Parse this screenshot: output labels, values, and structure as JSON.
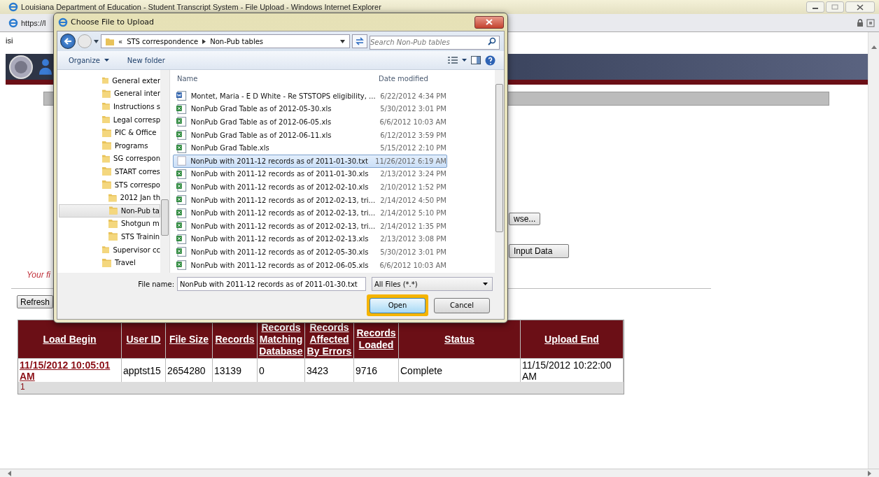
{
  "browser": {
    "title": "Louisiana Department of Education - Student Transcript System - File Upload - Windows Internet Explorer",
    "address": "https://l"
  },
  "page": {
    "user_text": "isi",
    "browse_button": "wse...",
    "input_button": "Input Data",
    "message": "Your fi",
    "refresh_button": "Refresh",
    "table": {
      "columns": [
        "Load Begin",
        "User ID",
        "File Size",
        "Records",
        "Records Matching Database",
        "Records Affected By Errors",
        "Records Loaded",
        "Status",
        "Upload End"
      ],
      "rows": [
        {
          "cells": [
            {
              "text": "11/15/2012 10:05:01 AM",
              "kind": "link"
            },
            {
              "text": "apptst15",
              "kind": "plain"
            },
            {
              "text": "2654280",
              "kind": "plain"
            },
            {
              "text": "13139",
              "kind": "plain"
            },
            {
              "text": "0",
              "kind": "plain"
            },
            {
              "text": "3423",
              "kind": "plain"
            },
            {
              "text": "9716",
              "kind": "plain"
            },
            {
              "text": "Complete",
              "kind": "plain"
            },
            {
              "text": "11/15/2012 10:22:00 AM",
              "kind": "plain"
            }
          ]
        }
      ],
      "pager": "1"
    }
  },
  "dialog": {
    "title": "Choose File to Upload",
    "breadcrumb_overflow": "«",
    "breadcrumb": [
      "STS correspondence",
      "Non-Pub tables"
    ],
    "search": {
      "placeholder": "Search Non-Pub tables"
    },
    "toolbar": [
      "Organize",
      "New folder"
    ],
    "tree": [
      {
        "label": "General exter",
        "selected": false
      },
      {
        "label": "General inter",
        "selected": false
      },
      {
        "label": "Instructions s",
        "selected": false
      },
      {
        "label": "Legal corresp",
        "selected": false
      },
      {
        "label": "PIC & Office",
        "selected": false
      },
      {
        "label": "Programs",
        "selected": false
      },
      {
        "label": "SG correspon",
        "selected": false
      },
      {
        "label": "START corres",
        "selected": false
      },
      {
        "label": "STS correspo",
        "selected": false,
        "children": [
          {
            "label": "2012 Jan th",
            "selected": false
          },
          {
            "label": "Non-Pub ta",
            "selected": true
          },
          {
            "label": "Shotgun m",
            "selected": false
          },
          {
            "label": "STS Trainin",
            "selected": false
          }
        ]
      },
      {
        "label": "Supervisor cc",
        "selected": false
      },
      {
        "label": "Travel",
        "selected": false
      }
    ],
    "columns": [
      "Name",
      "Date modified"
    ],
    "files": [
      {
        "name": "Montet, Maria - E D White - Re STSTOPS eligibility, ...",
        "date": "6/22/2012 4:34 PM",
        "kind": "word",
        "selected": false
      },
      {
        "name": "NonPub Grad Table as of 2012-05-30.xls",
        "date": "5/30/2012 3:01 PM",
        "kind": "excel",
        "selected": false
      },
      {
        "name": "NonPub Grad Table as of 2012-06-05.xls",
        "date": "6/6/2012 10:03 AM",
        "kind": "excel",
        "selected": false
      },
      {
        "name": "NonPub Grad Table as of 2012-06-11.xls",
        "date": "6/12/2012 3:59 PM",
        "kind": "excel",
        "selected": false
      },
      {
        "name": "NonPub Grad Table.xls",
        "date": "5/15/2012 2:10 PM",
        "kind": "excel",
        "selected": false
      },
      {
        "name": "NonPub with 2011-12 records as of 2011-01-30.txt",
        "date": "11/26/2012 6:19 AM",
        "kind": "text",
        "selected": true
      },
      {
        "name": "NonPub with 2011-12 records as of 2011-01-30.xls",
        "date": "2/13/2012 3:24 PM",
        "kind": "excel",
        "selected": false
      },
      {
        "name": "NonPub with 2011-12 records as of 2012-02-10.xls",
        "date": "2/10/2012 1:52 PM",
        "kind": "excel",
        "selected": false
      },
      {
        "name": "NonPub with 2011-12 records as of 2012-02-13, tri...",
        "date": "2/14/2012 4:50 PM",
        "kind": "excel",
        "selected": false
      },
      {
        "name": "NonPub with 2011-12 records as of 2012-02-13, tri...",
        "date": "2/14/2012 5:10 PM",
        "kind": "excel",
        "selected": false
      },
      {
        "name": "NonPub with 2011-12 records as of 2012-02-13, tri...",
        "date": "2/14/2012 1:35 PM",
        "kind": "excel",
        "selected": false
      },
      {
        "name": "NonPub with 2011-12 records as of 2012-02-13.xls",
        "date": "2/13/2012 3:08 PM",
        "kind": "excel",
        "selected": false
      },
      {
        "name": "NonPub with 2011-12 records as of 2012-05-30.xls",
        "date": "5/30/2012 3:01 PM",
        "kind": "excel",
        "selected": false
      },
      {
        "name": "NonPub with 2011-12 records as of 2012-06-05.xls",
        "date": "6/6/2012 10:03 AM",
        "kind": "excel",
        "selected": false
      }
    ],
    "file_name_label": "File name:",
    "file_name": "NonPub with 2011-12 records as of 2011-01-30.txt",
    "file_type": "All Files (*.*)",
    "buttons": [
      {
        "label": "Open",
        "highlighted": true
      },
      {
        "label": "Cancel",
        "highlighted": false
      }
    ]
  }
}
